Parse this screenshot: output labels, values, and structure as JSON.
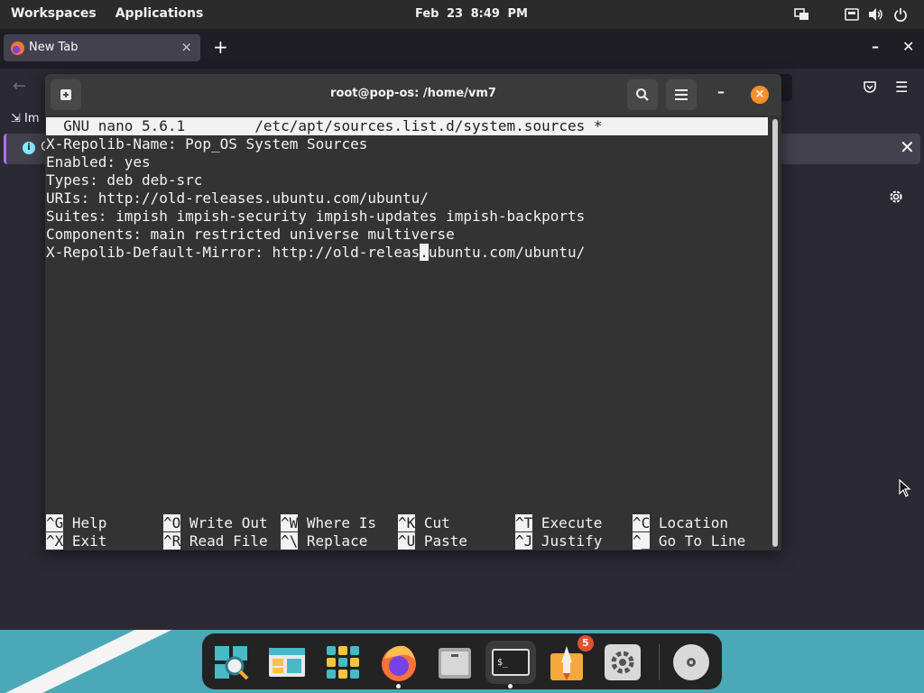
{
  "topbar": {
    "workspaces": "Workspaces",
    "applications": "Applications",
    "date": "Feb 23",
    "time": "8:49 PM"
  },
  "browser": {
    "tab_title": "New Tab",
    "tab_close": "×",
    "new_tab": "+",
    "minimize": "–",
    "close": "✕",
    "bookmark_item": "Im",
    "infobar_text": "C",
    "infobar_close": "✕"
  },
  "terminal": {
    "title": "root@pop-os: /home/vm7",
    "minimize": "–",
    "close": "×",
    "nano_header": "  GNU nano 5.6.1        /etc/apt/sources.list.d/system.sources *               ",
    "lines": [
      "X-Repolib-Name: Pop_OS System Sources",
      "Enabled: yes",
      "Types: deb deb-src",
      "URIs: http://old-releases.ubuntu.com/ubuntu/",
      "Suites: impish impish-security impish-updates impish-backports",
      "Components: main restricted universe multiverse"
    ],
    "mirror_line_before": "X-Repolib-Default-Mirror: http://old-releas",
    "mirror_line_cursor": ".",
    "mirror_line_after": "ubuntu.com/ubuntu/",
    "shortcuts_row1": [
      {
        "key": "^G",
        "label": " Help"
      },
      {
        "key": "^O",
        "label": " Write Out"
      },
      {
        "key": "^W",
        "label": " Where Is"
      },
      {
        "key": "^K",
        "label": " Cut"
      },
      {
        "key": "^T",
        "label": " Execute"
      },
      {
        "key": "^C",
        "label": " Location"
      }
    ],
    "shortcuts_row2": [
      {
        "key": "^X",
        "label": " Exit"
      },
      {
        "key": "^R",
        "label": " Read File"
      },
      {
        "key": "^\\",
        "label": " Replace"
      },
      {
        "key": "^U",
        "label": " Paste"
      },
      {
        "key": "^J",
        "label": " Justify"
      },
      {
        "key": "^_",
        "label": " Go To Line"
      }
    ]
  },
  "dock": {
    "apps": [
      "search-app",
      "files-manager",
      "app-library",
      "firefox",
      "file-cabinet",
      "terminal",
      "pop-shop",
      "settings",
      "disk-drive"
    ],
    "notification_count": "5",
    "accent": "#4aa8b8"
  }
}
